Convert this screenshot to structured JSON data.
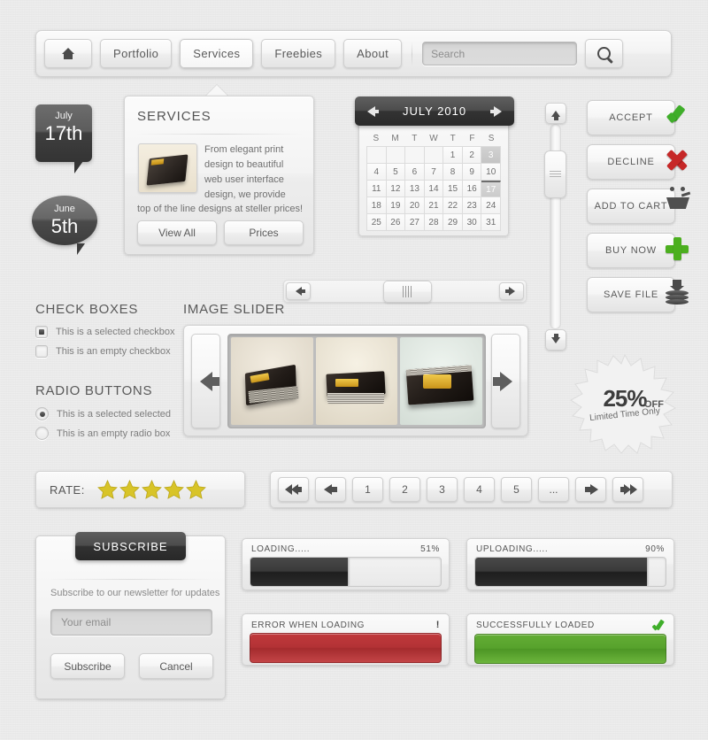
{
  "nav": {
    "home_icon": "home-icon",
    "items": [
      {
        "label": "Portfolio",
        "active": false
      },
      {
        "label": "Services",
        "active": true
      },
      {
        "label": "Freebies",
        "active": false
      },
      {
        "label": "About",
        "active": false
      }
    ],
    "search_placeholder": "Search",
    "search_value": "",
    "search_icon": "magnifier-icon"
  },
  "bubbles": [
    {
      "month": "July",
      "day": "17th",
      "shape": "square"
    },
    {
      "month": "June",
      "day": "5th",
      "shape": "round"
    }
  ],
  "services": {
    "title": "SERVICES",
    "body_right": "From elegant print design to beautiful web user interface design, we provide",
    "body_wrap": "top of the line designs at steller prices!",
    "buttons": [
      "View All",
      "Prices"
    ]
  },
  "calendar": {
    "month_label": "JULY 2010",
    "prev_icon": "arrow-left-icon",
    "next_icon": "arrow-right-icon",
    "weekdays": [
      "S",
      "M",
      "T",
      "W",
      "T",
      "F",
      "S"
    ],
    "leading_blanks": 4,
    "days": [
      1,
      2,
      3,
      4,
      5,
      6,
      7,
      8,
      9,
      10,
      11,
      12,
      13,
      14,
      15,
      16,
      17,
      18,
      19,
      20,
      21,
      22,
      23,
      24,
      25,
      26,
      27,
      28,
      29,
      30,
      31
    ],
    "highlighted_day": 3,
    "selected_day": 17
  },
  "actions": [
    {
      "label": "ACCEPT",
      "icon": "check-icon",
      "color": "#3fae2a"
    },
    {
      "label": "DECLINE",
      "icon": "cross-icon",
      "color": "#c62828"
    },
    {
      "label": "ADD TO CART",
      "icon": "shopping-cart-icon",
      "color": "#4f4f4f"
    },
    {
      "label": "BUY NOW",
      "icon": "plus-icon",
      "color": "#4caf1f"
    },
    {
      "label": "SAVE FILE",
      "icon": "save-download-icon",
      "color": "#4a4a4a"
    }
  ],
  "scrollbar": {
    "up_icon": "arrow-up-icon",
    "down_icon": "arrow-down-icon",
    "thumb": "scrollbar-thumb"
  },
  "checkboxes": {
    "heading": "CHECK BOXES",
    "items": [
      {
        "label": "This is a selected checkbox",
        "checked": true
      },
      {
        "label": "This is an empty checkbox",
        "checked": false
      }
    ]
  },
  "radios": {
    "heading": "RADIO BUTTONS",
    "items": [
      {
        "label": "This is a selected selected",
        "checked": true
      },
      {
        "label": "This is an empty radio box",
        "checked": false
      }
    ]
  },
  "hslider": {
    "left_icon": "arrow-left-icon",
    "right_icon": "arrow-right-icon",
    "thumb_position_pct": 42
  },
  "image_slider": {
    "heading": "IMAGE SLIDER",
    "prev_icon": "arrow-left-icon",
    "next_icon": "arrow-right-icon",
    "slides": [
      "business-card-stack-angled",
      "business-card-stack-front",
      "business-card-box-gotta-taeed"
    ]
  },
  "badge": {
    "percent": "25%",
    "off": "OFF",
    "subtitle": "Limited Time Only"
  },
  "rate": {
    "label": "RATE:",
    "stars_total": 5,
    "stars_filled": 5
  },
  "pagination": {
    "first_icon": "double-arrow-left-icon",
    "prev_icon": "arrow-left-icon",
    "pages": [
      "1",
      "2",
      "3",
      "4",
      "5",
      "..."
    ],
    "next_icon": "arrow-right-icon",
    "last_icon": "double-arrow-right-icon"
  },
  "subscribe": {
    "tab_label": "SUBSCRIBE",
    "description": "Subscribe to our newsletter for updates",
    "input_placeholder": "Your email",
    "input_value": "",
    "submit_label": "Subscribe",
    "cancel_label": "Cancel"
  },
  "progress": [
    {
      "label": "LOADING.....",
      "value": "51%",
      "percent": 51
    },
    {
      "label": "UPLOADING.....",
      "value": "90%",
      "percent": 90
    }
  ],
  "alerts": [
    {
      "label": "ERROR WHEN LOADING",
      "icon": "exclamation-icon",
      "glyph": "!",
      "state": "error",
      "color": "#b33235"
    },
    {
      "label": "SUCCESSFULLY LOADED",
      "icon": "check-icon",
      "glyph": "",
      "state": "success",
      "color": "#57a22c"
    }
  ]
}
